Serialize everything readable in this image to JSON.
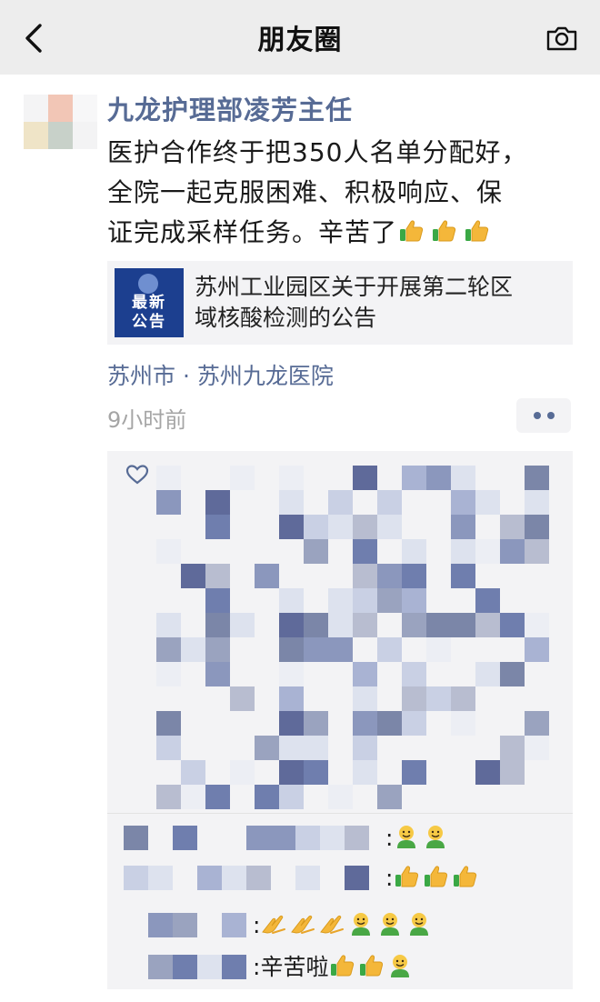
{
  "navbar": {
    "title": "朋友圈",
    "back_icon": "back-arrow-icon",
    "camera_icon": "camera-icon"
  },
  "post": {
    "author": "九龙护理部凌芳主任",
    "text_lines": [
      "医护合作终于把350人名单分配好，",
      "全院一起克服困难、积极响应、保",
      "证完成采样任务。辛苦了"
    ],
    "text_emoji": [
      "thumbs-up",
      "thumbs-up",
      "thumbs-up"
    ],
    "share": {
      "thumb_line1": "最新",
      "thumb_line2": "公告",
      "title_line1": "苏州工业园区关于开展第二轮区",
      "title_line2": "域核酸检测的公告"
    },
    "location": "苏州市 · 苏州九龙医院",
    "time": "9小时前"
  },
  "comments": [
    {
      "separator": ":",
      "text": "",
      "emoji": [
        "grinning-person",
        "grinning-person"
      ]
    },
    {
      "separator": ":",
      "text": "",
      "emoji": [
        "thumbs-up",
        "thumbs-up",
        "thumbs-up"
      ]
    },
    {
      "separator": ":",
      "text": "",
      "emoji": [
        "clap",
        "clap",
        "clap",
        "grinning-person",
        "grinning-person",
        "grinning-person"
      ]
    },
    {
      "separator": ":",
      "text": "辛苦啦",
      "emoji": [
        "thumbs-up",
        "thumbs-up",
        "grinning-person"
      ]
    }
  ],
  "colors": {
    "link_blue": "#576b95",
    "background_gray": "#f3f3f5",
    "navbar_gray": "#ededed",
    "thumbnail_blue": "#1c3f8f"
  }
}
